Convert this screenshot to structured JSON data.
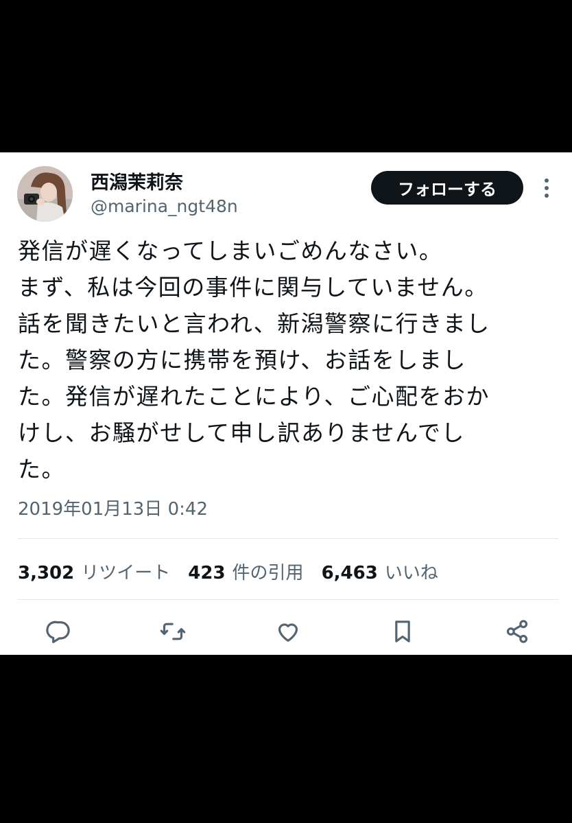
{
  "tweet": {
    "author": {
      "display_name": "西潟茉莉奈",
      "handle": "@marina_ngt48n"
    },
    "follow_label": "フォローする",
    "text_lines": [
      "発信が遅くなってしまいごめんなさい。",
      "まず、私は今回の事件に関与していません。",
      "話を聞きたいと言われ、新潟警察に行きまし",
      "た。警察の方に携帯を預け、お話をしまし",
      "た。発信が遅れたことにより、ご心配をおか",
      "けし、お騒がせして申し訳ありませんでし",
      "た。"
    ],
    "timestamp": "2019年01月13日 0:42",
    "stats": {
      "retweets": {
        "count": "3,302",
        "label": "リツイート"
      },
      "quotes": {
        "count": "423",
        "label": "件の引用"
      },
      "likes": {
        "count": "6,463",
        "label": "いいね"
      }
    }
  },
  "icons": {
    "more": "more-icon",
    "reply": "reply-icon",
    "retweet": "retweet-icon",
    "like": "like-icon",
    "bookmark": "bookmark-icon",
    "share": "share-icon"
  },
  "colors": {
    "background": "#000000",
    "card": "#ffffff",
    "primary_text": "#0f1419",
    "secondary_text": "#536471",
    "follow_button": "#0f1419",
    "divider": "#e4e8ea"
  }
}
